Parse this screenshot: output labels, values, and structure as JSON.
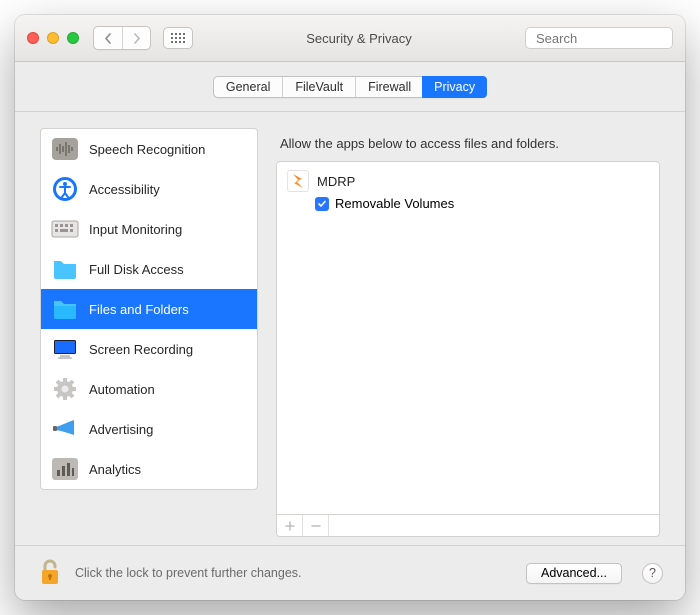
{
  "window": {
    "title": "Security & Privacy"
  },
  "search": {
    "placeholder": "Search"
  },
  "tabs": [
    {
      "label": "General"
    },
    {
      "label": "FileVault"
    },
    {
      "label": "Firewall"
    },
    {
      "label": "Privacy",
      "active": true
    }
  ],
  "sidebar": {
    "items": [
      {
        "label": "Speech Recognition",
        "icon": "waveform-icon"
      },
      {
        "label": "Accessibility",
        "icon": "accessibility-icon"
      },
      {
        "label": "Input Monitoring",
        "icon": "keyboard-icon"
      },
      {
        "label": "Full Disk Access",
        "icon": "disk-icon"
      },
      {
        "label": "Files and Folders",
        "icon": "folder-icon",
        "selected": true
      },
      {
        "label": "Screen Recording",
        "icon": "display-icon"
      },
      {
        "label": "Automation",
        "icon": "gear-icon"
      },
      {
        "label": "Advertising",
        "icon": "megaphone-icon"
      },
      {
        "label": "Analytics",
        "icon": "barchart-icon"
      }
    ]
  },
  "details": {
    "description": "Allow the apps below to access files and folders.",
    "apps": [
      {
        "name": "MDRP",
        "permissions": [
          {
            "label": "Removable Volumes",
            "checked": true
          }
        ]
      }
    ]
  },
  "footer": {
    "lock_text": "Click the lock to prevent further changes.",
    "advanced_label": "Advanced...",
    "help_label": "?"
  }
}
